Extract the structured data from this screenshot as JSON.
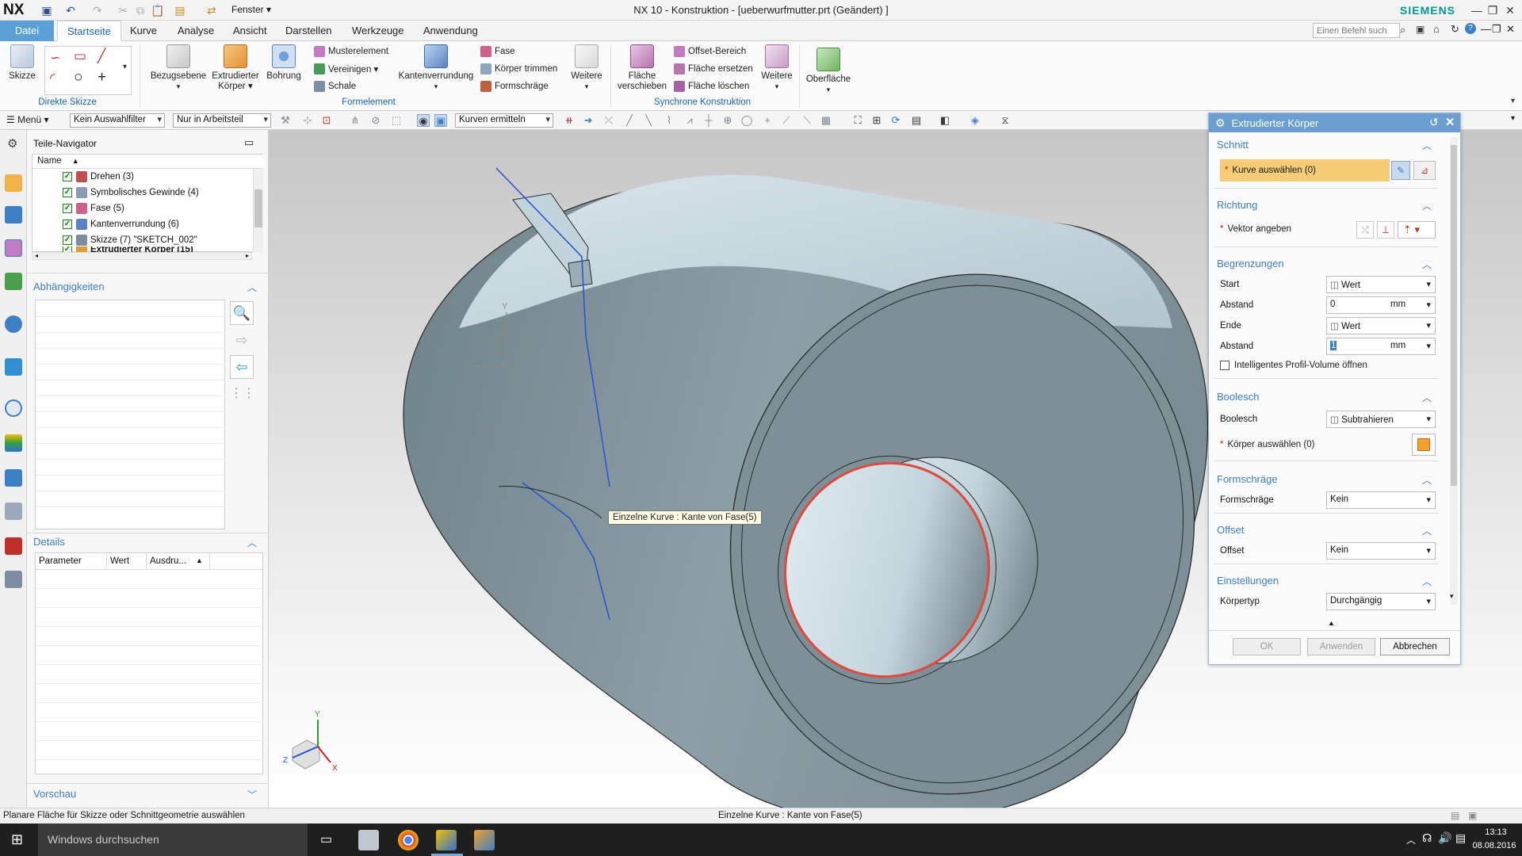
{
  "app": {
    "logo": "NX",
    "title": "NX 10 - Konstruktion - [ueberwurfmutter.prt (Geändert) ]",
    "brand": "SIEMENS",
    "window_menu": "Fenster ▾"
  },
  "tabs": [
    {
      "label": "Datei"
    },
    {
      "label": "Startseite"
    },
    {
      "label": "Kurve"
    },
    {
      "label": "Analyse"
    },
    {
      "label": "Ansicht"
    },
    {
      "label": "Darstellen"
    },
    {
      "label": "Werkzeuge"
    },
    {
      "label": "Anwendung"
    }
  ],
  "command_search": {
    "placeholder": "Einen Befehl such"
  },
  "ribbon": {
    "skizze": "Skizze",
    "direkte_skizze": "Direkte Skizze",
    "bezugsebene": "Bezugsebene",
    "extrudierter_koerper_1": "Extrudierter",
    "extrudierter_koerper_2": "Körper ▾",
    "bohrung": "Bohrung",
    "musterelement": "Musterelement",
    "vereinigen": "Vereinigen ▾",
    "schale": "Schale",
    "kantenverrundung": "Kantenverrundung",
    "fase": "Fase",
    "koerper_trimmen": "Körper trimmen",
    "formschraege": "Formschräge",
    "weitere": "Weitere",
    "formelement": "Formelement",
    "flaeche_verschieben_1": "Fläche",
    "flaeche_verschieben_2": "verschieben",
    "offset_bereich": "Offset-Bereich",
    "flaeche_ersetzen": "Fläche ersetzen",
    "flaeche_loeschen": "Fläche löschen",
    "weitere2": "Weitere",
    "synchrone": "Synchrone Konstruktion",
    "oberflaeche": "Oberfläche"
  },
  "toolbar": {
    "menu": "Menü ▾",
    "filter": "Kein Auswahlfilter",
    "scope": "Nur in Arbeitsteil",
    "curve_rule": "Kurven ermitteln"
  },
  "navigator": {
    "title": "Teile-Navigator",
    "col_name": "Name",
    "items": [
      {
        "label": "Drehen (3)",
        "color": "#c0504d"
      },
      {
        "label": "Symbolisches Gewinde (4)",
        "color": "#8c9ab3"
      },
      {
        "label": "Fase (5)",
        "color": "#d0608a"
      },
      {
        "label": "Kantenverrundung (6)",
        "color": "#5b82c4"
      },
      {
        "label": "Skizze (7) \"SKETCH_002\"",
        "color": "#7e8c9e"
      },
      {
        "label": "Extrudierter Körper (15)",
        "color": "#e69a2e"
      }
    ],
    "dependencies": "Abhängigkeiten",
    "details": "Details",
    "details_cols": [
      "Parameter",
      "Wert",
      "Ausdru..."
    ],
    "preview": "Vorschau"
  },
  "viewport": {
    "tooltip": "Einzelne Kurve : Kante von Fase(5)",
    "axis_x": "X",
    "axis_y": "Y",
    "axis_z": "Z"
  },
  "dialog": {
    "title": "Extrudierter Körper",
    "sec_schnitt": "Schnitt",
    "kurve_auswaehlen": "Kurve auswählen (0)",
    "sec_richtung": "Richtung",
    "vektor": "Vektor angeben",
    "sec_begrenzungen": "Begrenzungen",
    "start_label": "Start",
    "start_value": "Wert",
    "abstand1_label": "Abstand",
    "abstand1_value": "0",
    "abstand1_unit": "mm",
    "ende_label": "Ende",
    "ende_value": "Wert",
    "abstand2_label": "Abstand",
    "abstand2_value": "1",
    "abstand2_unit": "mm",
    "profile_volume": "Intelligentes Profil-Volume öffnen",
    "sec_boolesch": "Boolesch",
    "boolesch_label": "Boolesch",
    "boolesch_value": "Subtrahieren",
    "koerper_auswaehlen": "Körper auswählen (0)",
    "sec_formschraege": "Formschräge",
    "formschraege_label": "Formschräge",
    "formschraege_value": "Kein",
    "sec_offset": "Offset",
    "offset_label": "Offset",
    "offset_value": "Kein",
    "sec_einstellungen": "Einstellungen",
    "koerpertyp_label": "Körpertyp",
    "koerpertyp_value": "Durchgängig",
    "btn_ok": "OK",
    "btn_anwenden": "Anwenden",
    "btn_abbrechen": "Abbrechen"
  },
  "status": {
    "left": "Planare Fläche für Skizze oder Schnittgeometrie auswählen",
    "center": "Einzelne Kurve : Kante von Fase(5)"
  },
  "taskbar": {
    "search_placeholder": "Windows durchsuchen",
    "time": "13:13",
    "date": "08.08.2016"
  }
}
